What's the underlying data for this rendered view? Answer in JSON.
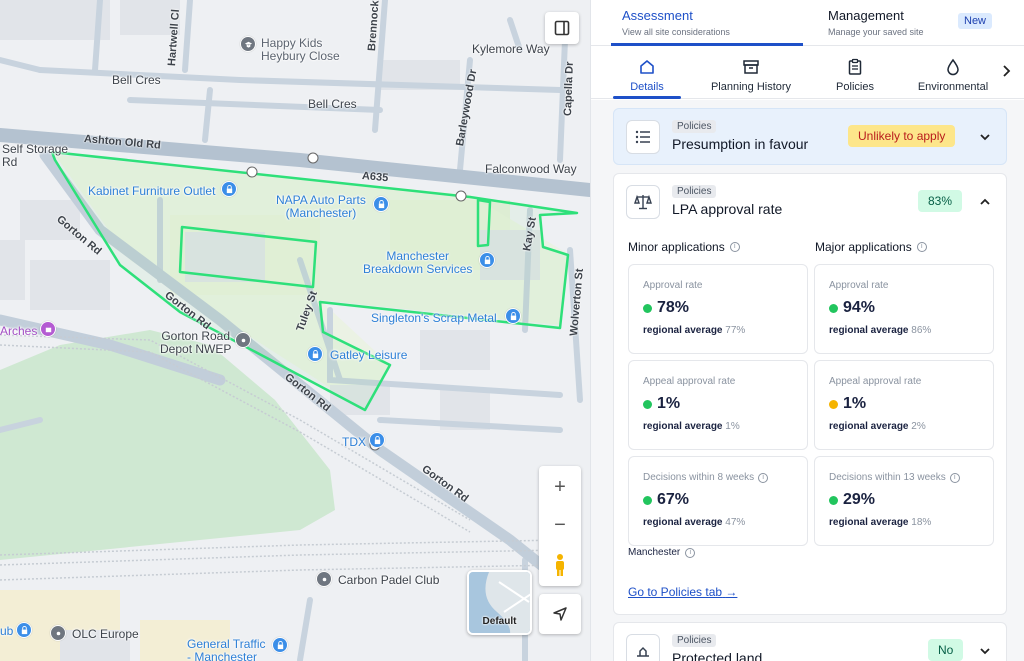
{
  "map": {
    "labels": {
      "happy_kids": "Happy Kids\nHeybury Close",
      "kylemore": "Kylemore Way",
      "bell_cres_1": "Bell Cres",
      "bell_cres_2": "Bell Cres",
      "self_storage": "Self Storage",
      "rd_left": "Rd",
      "falconwood": "Falconwood Way",
      "kabinet": "Kabinet Furniture Outlet",
      "napa": "NAPA Auto Parts\n(Manchester)",
      "manchester_breakdown": "Manchester\nBreakdown Services",
      "singletons": "Singleton's Scrap Metal",
      "arches": "Arches",
      "gorton_depot": "Gorton Road\nDepot NWEP",
      "gatley": "Gatley Leisure",
      "tdx": "TDX",
      "carbon_padel": "Carbon Padel Club",
      "olc": "OLC Europe",
      "general_traffic": "General Traffic\n- Manchester",
      "ub": "ub"
    },
    "roads": {
      "hartwell": "Hartwell Cl",
      "brennock": "Brennock",
      "ashton": "Ashton Old Rd",
      "a635": "A635",
      "barleywood": "Barleywood Dr",
      "capella": "Capella Dr",
      "kay": "Kay St",
      "wolverton": "Wolverton St",
      "gorton1": "Gorton Rd",
      "gorton2": "Gorton Rd",
      "gorton3": "Gorton Rd",
      "gorton4": "Gorton Rd",
      "tuley": "Tuley St"
    },
    "controls": {
      "zoom_in": "+",
      "zoom_out": "−",
      "layer_label": "Default"
    }
  },
  "panel": {
    "top_tabs": {
      "assessment": {
        "title": "Assessment",
        "subtitle": "View all site considerations"
      },
      "management": {
        "title": "Management",
        "subtitle": "Manage your saved site"
      },
      "new_badge": "New"
    },
    "sub_tabs": [
      "Details",
      "Planning History",
      "Policies",
      "Environmental"
    ],
    "cards": {
      "presumption": {
        "tag": "Policies",
        "title": "Presumption in favour",
        "status": "Unlikely to apply"
      },
      "lpa": {
        "tag": "Policies",
        "title": "LPA approval rate",
        "status": "83%",
        "minor_heading": "Minor applications",
        "major_heading": "Major applications",
        "regional_prefix": "regional average",
        "stats": {
          "minor_approval": {
            "label": "Approval rate",
            "value": "78%",
            "regional": "77%"
          },
          "major_approval": {
            "label": "Approval rate",
            "value": "94%",
            "regional": "86%"
          },
          "minor_appeal": {
            "label": "Appeal approval rate",
            "value": "1%",
            "regional": "1%"
          },
          "major_appeal": {
            "label": "Appeal approval rate",
            "value": "1%",
            "regional": "2%"
          },
          "minor_decisions": {
            "label": "Decisions within 8 weeks",
            "value": "67%",
            "regional": "47%"
          },
          "major_decisions": {
            "label": "Decisions within 13 weeks",
            "value": "29%",
            "regional": "18%"
          }
        },
        "region": "Manchester",
        "link": "Go to Policies tab"
      },
      "protected": {
        "tag": "Policies",
        "title": "Protected land",
        "status": "No"
      }
    },
    "colors": {
      "accent": "#1e50c8",
      "dot_green": "#22c55e",
      "dot_amber": "#f5b400",
      "status_warn_bg": "#fde68a",
      "status_warn_fg": "#b91c1c",
      "status_ok_bg": "#d1fae5",
      "status_ok_fg": "#065f46",
      "site_outline": "#2ee07a"
    }
  }
}
